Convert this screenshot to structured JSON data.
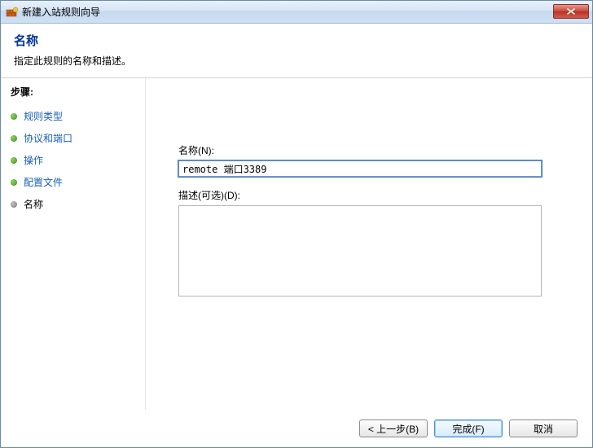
{
  "window": {
    "title": "新建入站规则向导"
  },
  "header": {
    "title": "名称",
    "subtitle": "指定此规则的名称和描述。"
  },
  "sidebar": {
    "steps_label": "步骤:",
    "items": [
      {
        "label": "规则类型",
        "current": false
      },
      {
        "label": "协议和端口",
        "current": false
      },
      {
        "label": "操作",
        "current": false
      },
      {
        "label": "配置文件",
        "current": false
      },
      {
        "label": "名称",
        "current": true
      }
    ]
  },
  "content": {
    "name_label": "名称(N):",
    "name_value": "remote 端口3389",
    "desc_label": "描述(可选)(D):",
    "desc_value": ""
  },
  "footer": {
    "back_label": "< 上一步(B)",
    "finish_label": "完成(F)",
    "cancel_label": "取消"
  }
}
